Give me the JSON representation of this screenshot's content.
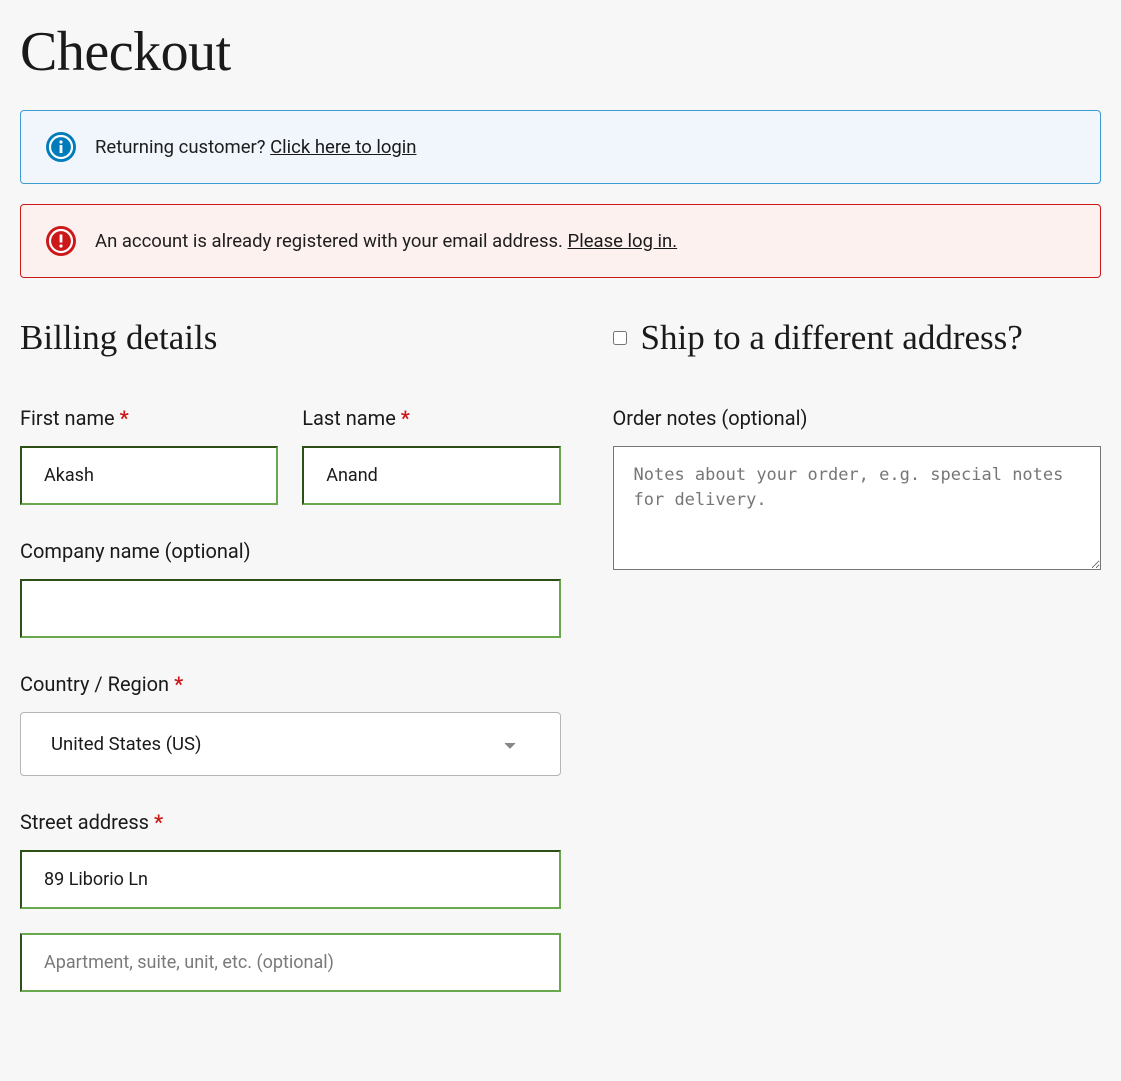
{
  "page_title": "Checkout",
  "notices": {
    "info_prefix": "Returning customer? ",
    "info_link": "Click here to login",
    "error_prefix": "An account is already registered with your email address. ",
    "error_link": "Please log in."
  },
  "billing": {
    "heading": "Billing details",
    "first_name_label": "First name ",
    "first_name_value": "Akash",
    "last_name_label": "Last name ",
    "last_name_value": "Anand",
    "company_label": "Company name (optional)",
    "company_value": "",
    "country_label": "Country / Region ",
    "country_value": "United States (US)",
    "street_label": "Street address ",
    "street1_value": "89 Liborio Ln",
    "street2_placeholder": "Apartment, suite, unit, etc. (optional)",
    "street2_value": ""
  },
  "shipping": {
    "heading": "Ship to a different address?",
    "notes_label": "Order notes (optional)",
    "notes_placeholder": "Notes about your order, e.g. special notes for delivery.",
    "notes_value": ""
  },
  "required_marker": "*"
}
